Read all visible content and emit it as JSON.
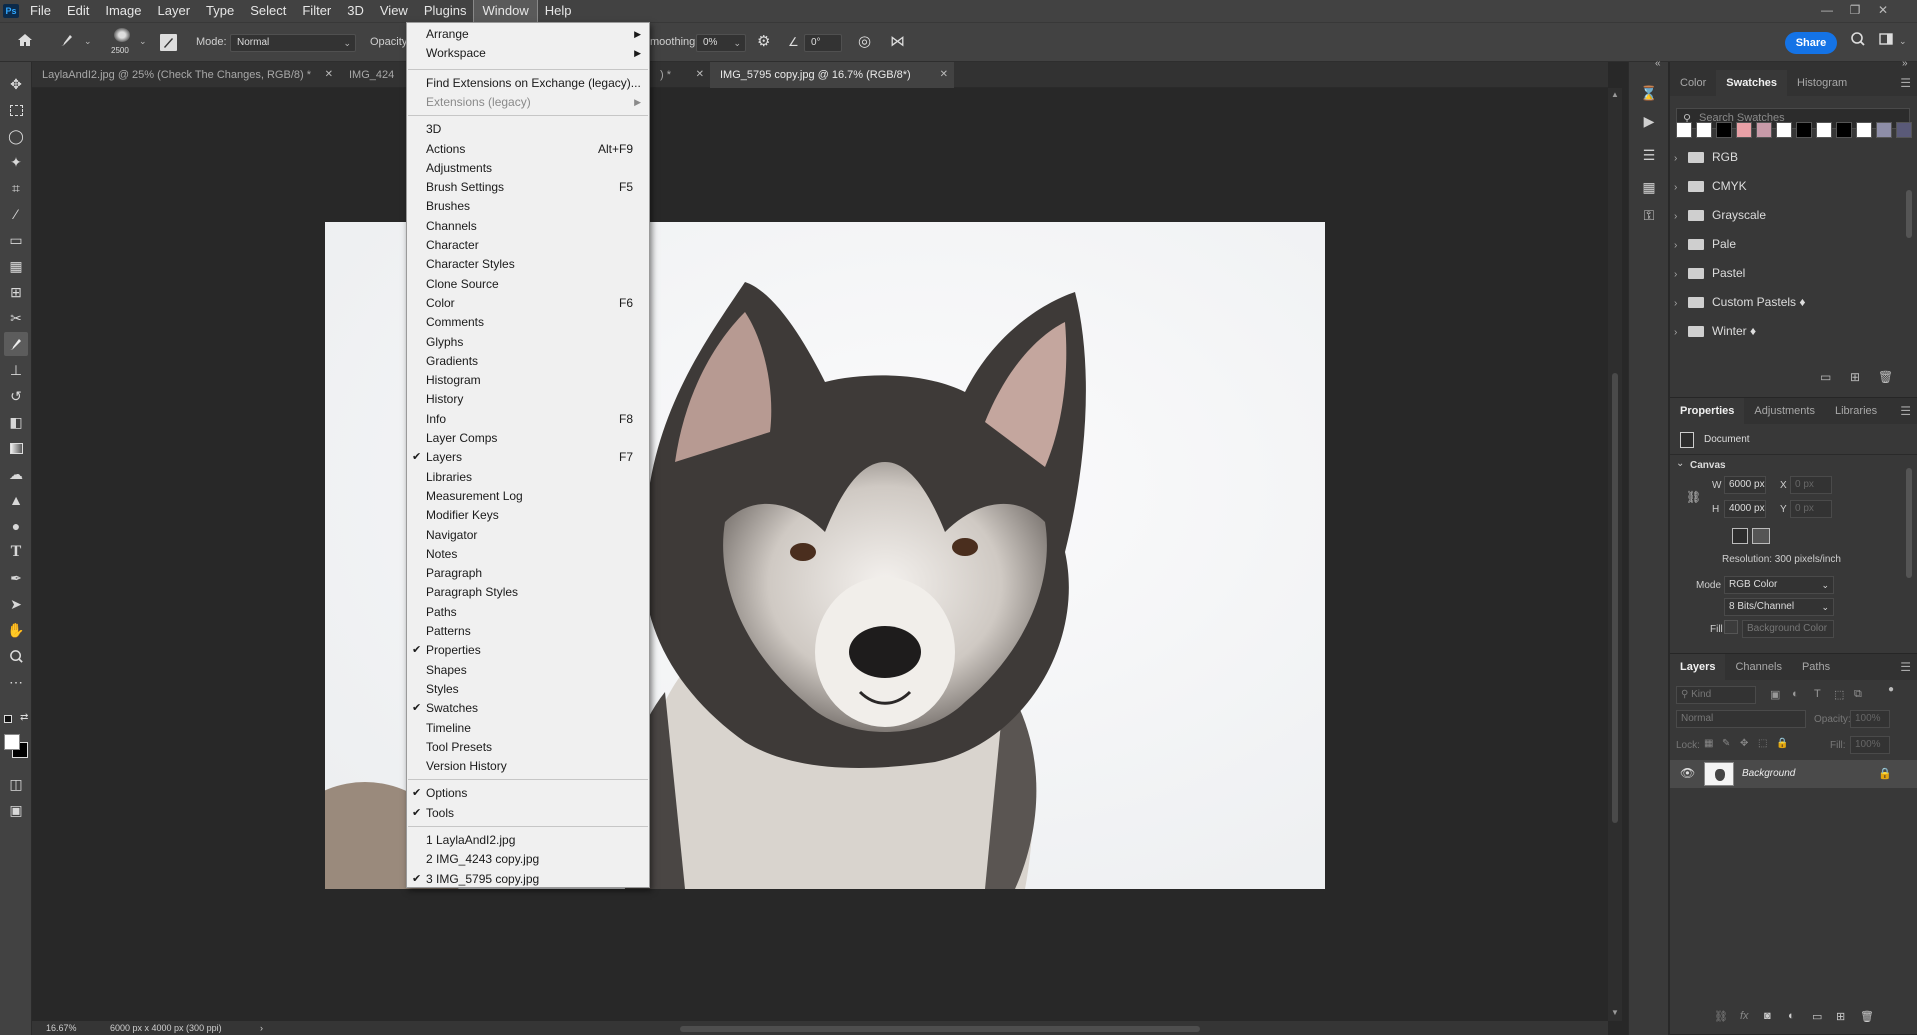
{
  "menubar": {
    "logo": "Ps",
    "items": [
      "File",
      "Edit",
      "Image",
      "Layer",
      "Type",
      "Select",
      "Filter",
      "3D",
      "View",
      "Plugins",
      "Window",
      "Help"
    ],
    "active": "Window",
    "window_controls": [
      "—",
      "❐",
      "✕"
    ]
  },
  "options_bar": {
    "brush_size": "2500",
    "mode_label": "Mode:",
    "mode_value": "Normal",
    "opacity_label": "Opacity:",
    "smoothing_label": "moothing:",
    "smoothing_value": "0%",
    "angle_value": "0°",
    "share_label": "Share"
  },
  "tabs": [
    {
      "label": "LaylaAndI2.jpg @ 25% (Check The Changes, RGB/8) *",
      "active": false
    },
    {
      "label": "IMG_424",
      "active": false
    },
    {
      "label": ") *",
      "active": false
    },
    {
      "label": "IMG_5795 copy.jpg @ 16.7% (RGB/8*)",
      "active": true
    }
  ],
  "window_menu": {
    "group1": [
      {
        "label": "Arrange",
        "submenu": true
      },
      {
        "label": "Workspace",
        "submenu": true
      }
    ],
    "group2": [
      {
        "label": "Find Extensions on Exchange (legacy)...",
        "disabled": false
      },
      {
        "label": "Extensions (legacy)",
        "disabled": true,
        "submenu": true
      }
    ],
    "group3": [
      {
        "label": "3D"
      },
      {
        "label": "Actions",
        "shortcut": "Alt+F9"
      },
      {
        "label": "Adjustments"
      },
      {
        "label": "Brush Settings",
        "shortcut": "F5"
      },
      {
        "label": "Brushes"
      },
      {
        "label": "Channels"
      },
      {
        "label": "Character"
      },
      {
        "label": "Character Styles"
      },
      {
        "label": "Clone Source"
      },
      {
        "label": "Color",
        "shortcut": "F6"
      },
      {
        "label": "Comments"
      },
      {
        "label": "Glyphs"
      },
      {
        "label": "Gradients"
      },
      {
        "label": "Histogram"
      },
      {
        "label": "History"
      },
      {
        "label": "Info",
        "shortcut": "F8"
      },
      {
        "label": "Layer Comps"
      },
      {
        "label": "Layers",
        "shortcut": "F7",
        "checked": true
      },
      {
        "label": "Libraries"
      },
      {
        "label": "Measurement Log"
      },
      {
        "label": "Modifier Keys"
      },
      {
        "label": "Navigator"
      },
      {
        "label": "Notes"
      },
      {
        "label": "Paragraph"
      },
      {
        "label": "Paragraph Styles"
      },
      {
        "label": "Paths"
      },
      {
        "label": "Patterns"
      },
      {
        "label": "Properties",
        "checked": true
      },
      {
        "label": "Shapes"
      },
      {
        "label": "Styles"
      },
      {
        "label": "Swatches",
        "checked": true
      },
      {
        "label": "Timeline"
      },
      {
        "label": "Tool Presets"
      },
      {
        "label": "Version History"
      }
    ],
    "group4": [
      {
        "label": "Options",
        "checked": true
      },
      {
        "label": "Tools",
        "checked": true
      }
    ],
    "group5": [
      {
        "label": "1 LaylaAndI2.jpg"
      },
      {
        "label": "2 IMG_4243 copy.jpg"
      },
      {
        "label": "3 IMG_5795 copy.jpg",
        "checked": true
      }
    ]
  },
  "swatches_panel": {
    "tabs": [
      "Color",
      "Swatches",
      "Histogram"
    ],
    "active_tab": "Swatches",
    "search_placeholder": "Search Swatches",
    "recent_colors": [
      "#ffffff",
      "#ffffff",
      "#000000",
      "#e8a0a6",
      "#c79aa8",
      "#ffffff",
      "#000000",
      "#ffffff",
      "#000000",
      "#ffffff",
      "#8e8ea8",
      "#5a5a78"
    ],
    "folders": [
      "RGB",
      "CMYK",
      "Grayscale",
      "Pale",
      "Pastel",
      "Custom Pastels ♦",
      "Winter ♦"
    ]
  },
  "properties_panel": {
    "tabs": [
      "Properties",
      "Adjustments",
      "Libraries"
    ],
    "active_tab": "Properties",
    "doc_label": "Document",
    "canvas_header": "Canvas",
    "w_label": "W",
    "w_value": "6000 px",
    "h_label": "H",
    "h_value": "4000 px",
    "x_label": "X",
    "x_placeholder": "0 px",
    "y_label": "Y",
    "y_placeholder": "0 px",
    "resolution": "Resolution: 300 pixels/inch",
    "mode_label": "Mode",
    "mode_value": "RGB Color",
    "bits_value": "8 Bits/Channel",
    "fill_label": "Fill",
    "fill_value": "Background Color"
  },
  "layers_panel": {
    "tabs": [
      "Layers",
      "Channels",
      "Paths"
    ],
    "active_tab": "Layers",
    "kind_placeholder": "Kind",
    "blend_mode": "Normal",
    "opacity_label": "Opacity:",
    "opacity_value": "100%",
    "lock_label": "Lock:",
    "fill_label": "Fill:",
    "fill_value": "100%",
    "layer_name": "Background"
  },
  "status": {
    "zoom": "16.67%",
    "doc_info": "6000 px x 4000 px (300 ppi)"
  },
  "colors": {
    "accent": "#1473e6",
    "menu_bg": "#f0f0f0",
    "ui_bg": "#424242"
  }
}
